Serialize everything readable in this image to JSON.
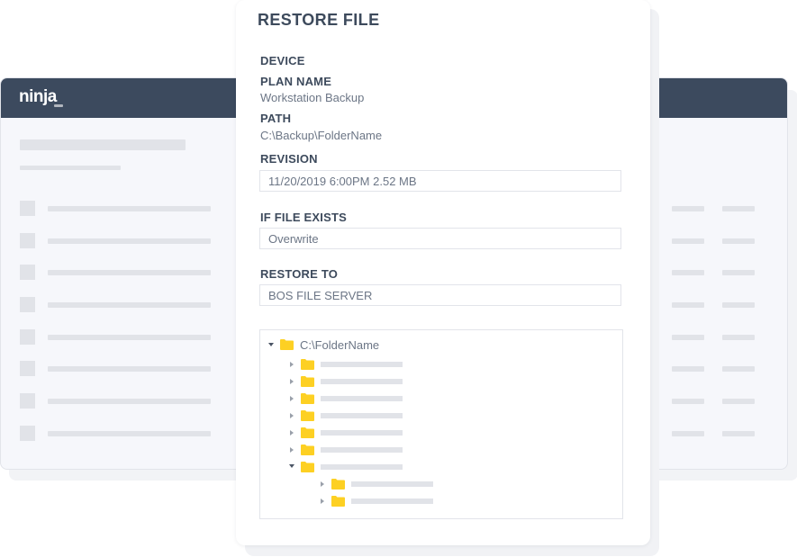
{
  "background_app": {
    "logo_text": "ninja"
  },
  "dialog": {
    "title": "RESTORE FILE",
    "device_label": "DEVICE",
    "plan_name_label": "PLAN NAME",
    "plan_name_value": "Workstation Backup",
    "path_label": "PATH",
    "path_value": "C:\\Backup\\FolderName",
    "revision_label": "REVISION",
    "revision_value": "11/20/2019 6:00PM 2.52 MB",
    "if_file_exists_label": "IF FILE EXISTS",
    "if_file_exists_value": "Overwrite",
    "restore_to_label": "RESTORE TO",
    "restore_to_value": "BOS FILE SERVER",
    "tree": {
      "root_label": "C:\\FolderName"
    }
  },
  "colors": {
    "header": "#3c4a5e",
    "folder": "#fdd023",
    "heading_text": "#3d4a5c",
    "value_text": "#6c7686"
  },
  "icons": {
    "folder": "folder-icon",
    "expand": "caret-right-icon",
    "collapse": "caret-down-icon"
  }
}
